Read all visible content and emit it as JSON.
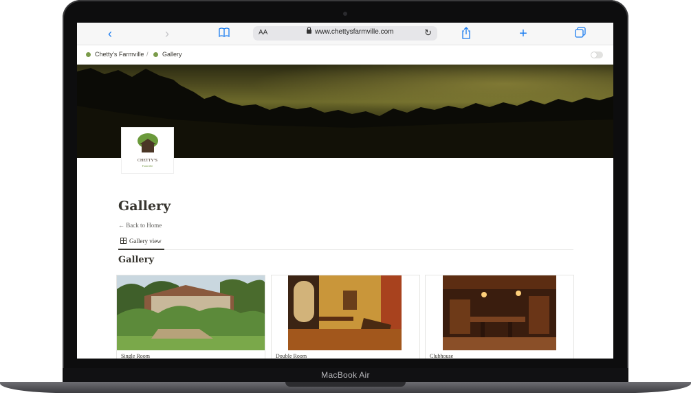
{
  "browser": {
    "url": "www.chettysfarmville.com",
    "aa_label": "AA",
    "icons": [
      "back-icon",
      "forward-icon",
      "bookmarks-icon",
      "lock-icon",
      "reload-icon",
      "share-icon",
      "new-tab-icon",
      "tabs-icon"
    ]
  },
  "breadcrumb": {
    "items": [
      {
        "label": "Chetty’s Farmville"
      },
      {
        "label": "Gallery"
      }
    ],
    "separator": "/"
  },
  "logo": {
    "name": "CHETTY’S",
    "sub": "Farmville"
  },
  "page": {
    "title": "Gallery",
    "back_link": "← Back to Home",
    "view_tab": "Gallery view",
    "section_title": "Gallery"
  },
  "cards": [
    {
      "label": "Single Room"
    },
    {
      "label": "Double Room"
    },
    {
      "label": "Clubhouse"
    }
  ],
  "device": {
    "brand": "MacBook Air"
  },
  "colors": {
    "safari_blue": "#1a7cf0",
    "notion_text": "#37352f"
  }
}
